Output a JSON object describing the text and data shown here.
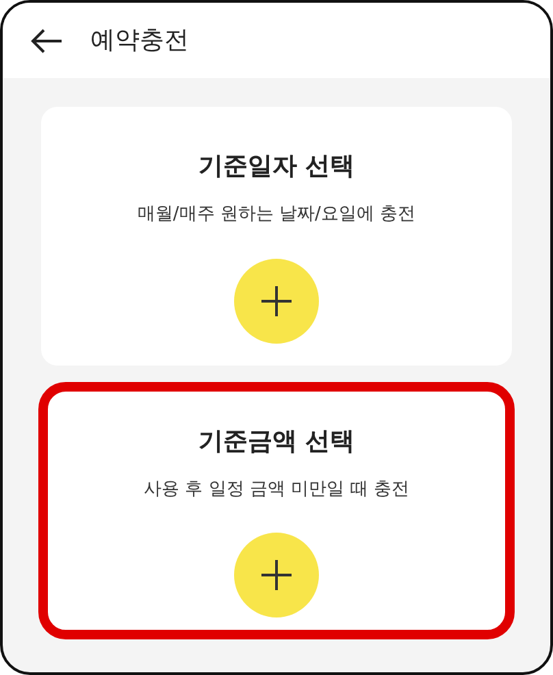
{
  "header": {
    "title": "예약충전"
  },
  "options": [
    {
      "title": "기준일자 선택",
      "description": "매월/매주 원하는 날짜/요일에 충전",
      "highlighted": false
    },
    {
      "title": "기준금액 선택",
      "description": "사용 후 일정 금액 미만일 때 충전",
      "highlighted": true
    }
  ]
}
